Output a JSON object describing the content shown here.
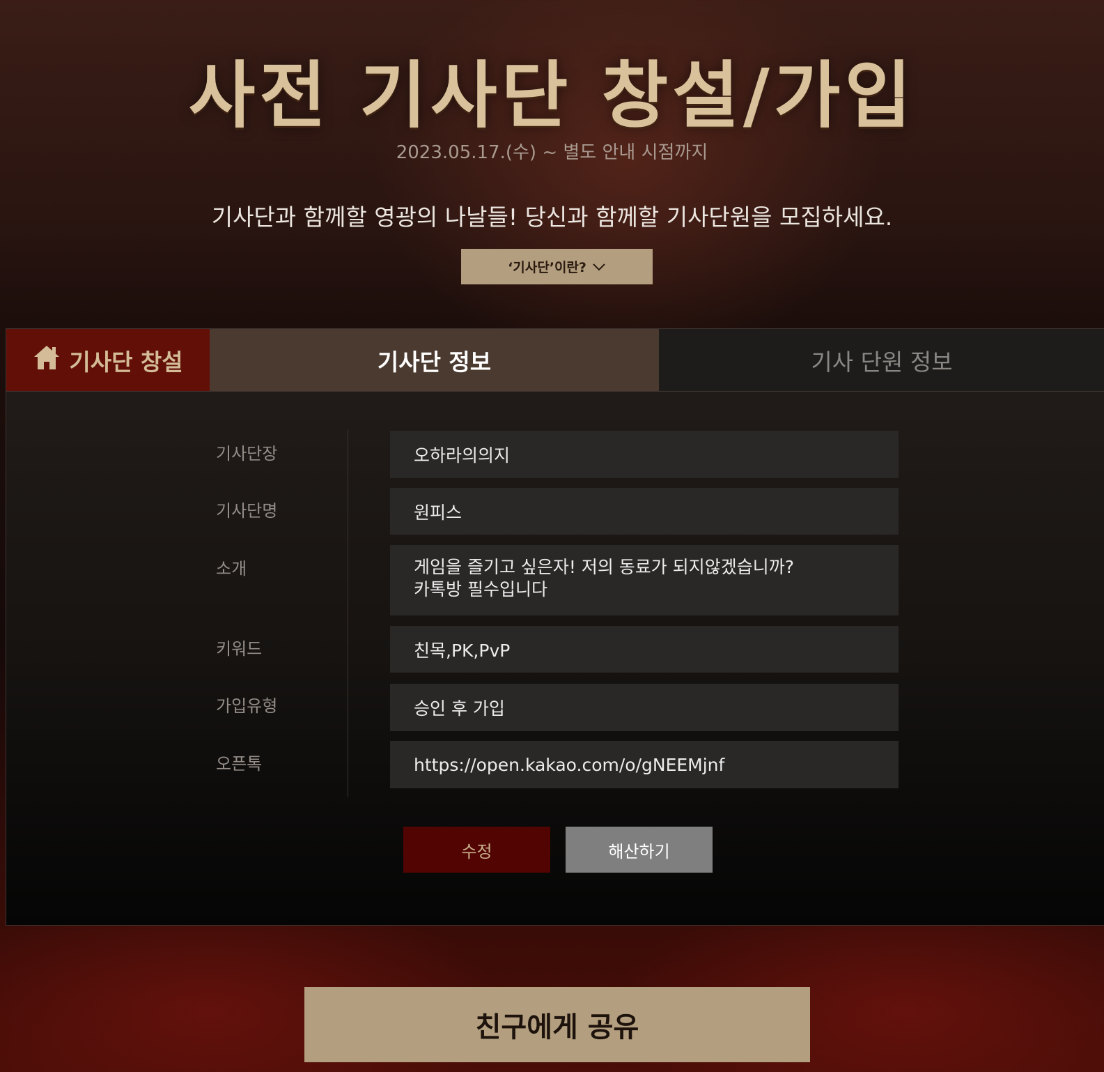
{
  "hero": {
    "title": "사전 기사단 창설/가입",
    "date": "2023.05.17.(수) ~ 별도 안내 시점까지",
    "tagline": "기사단과 함께할 영광의 나날들! 당신과 함께할 기사단원을 모집하세요.",
    "info_toggle_label": "‘기사단’이란?",
    "info_toggle_icon": "chevron-down-icon"
  },
  "tabs": {
    "create_label": "기사단 창설",
    "create_icon": "home-icon",
    "info_label": "기사단 정보",
    "members_label": "기사 단원 정보"
  },
  "form": {
    "leader": {
      "label": "기사단장",
      "value": "오하라의의지"
    },
    "name": {
      "label": "기사단명",
      "value": "원피스"
    },
    "intro": {
      "label": "소개",
      "lines": [
        "게임을 즐기고 싶은자! 저의 동료가 되지않겠습니까?",
        "카톡방 필수입니다"
      ]
    },
    "keywords": {
      "label": "키워드",
      "value": "친목,PK,PvP"
    },
    "join_type": {
      "label": "가입유형",
      "value": "승인 후 가입"
    },
    "open_chat": {
      "label": "오픈톡",
      "value": "https://open.kakao.com/o/gNEEMjnf"
    }
  },
  "actions": {
    "edit_label": "수정",
    "disband_label": "해산하기"
  },
  "share": {
    "label": "친구에게 공유"
  },
  "colors": {
    "gold": "#b39f7f",
    "title_gold": "#d9c29b",
    "crimson": "#620f08",
    "edit_button": "#520403",
    "tab_active": "#4b3a2f",
    "field_bg": "#2a2827"
  }
}
